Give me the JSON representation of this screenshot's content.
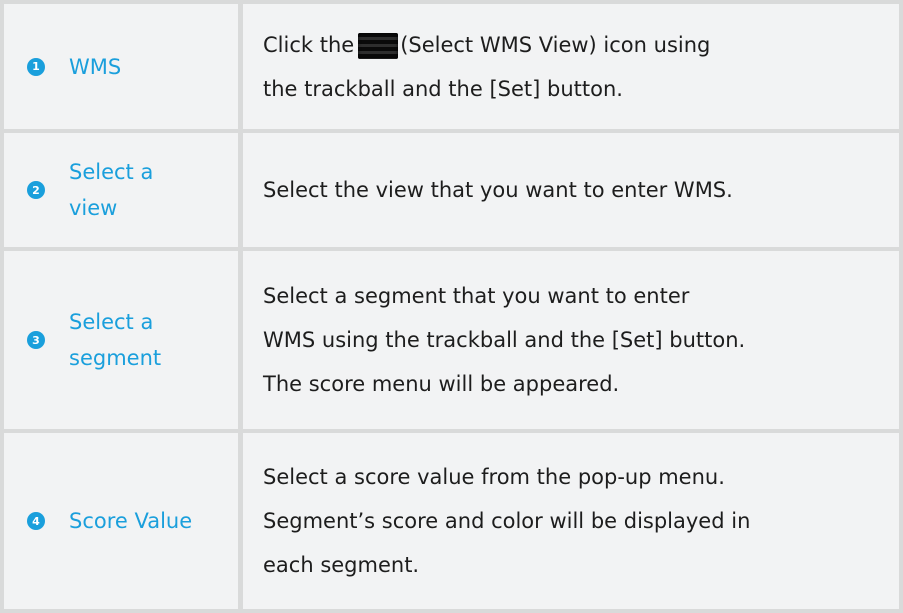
{
  "rows": [
    {
      "number": "1",
      "label": "WMS",
      "desc_before": "Click the",
      "icon": "select-wms-view-icon",
      "desc_after": "(Select WMS View) icon using\nthe trackball and the [Set] button."
    },
    {
      "number": "2",
      "label": "Select a\nview",
      "desc": "Select the view that you want to enter WMS."
    },
    {
      "number": "3",
      "label": "Select a\nsegment",
      "desc": " Select a segment that you want to enter\nWMS using the trackball and the [Set] button.\nThe score menu will be appeared."
    },
    {
      "number": "4",
      "label": "Score Value",
      "desc": " Select a score value from the pop-up menu.\nSegment’s score and color will be displayed in\neach segment."
    }
  ],
  "colors": {
    "accent": "#1a9fdc",
    "cell_bg": "#f2f3f4",
    "grid": "#d9dada",
    "text": "#1d1d1d"
  }
}
